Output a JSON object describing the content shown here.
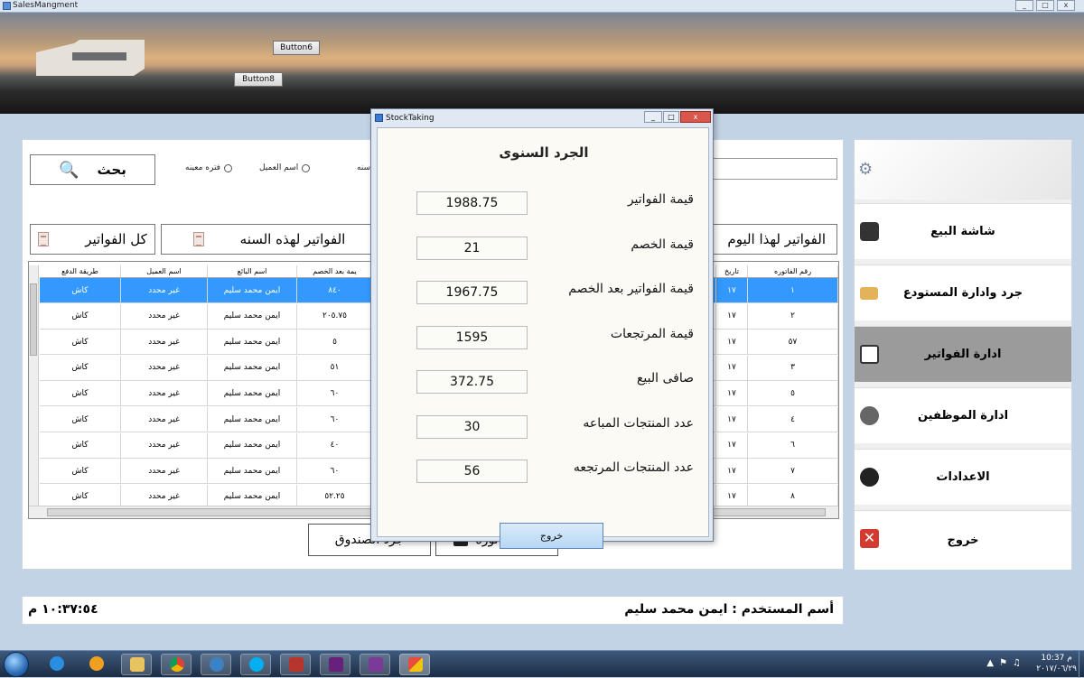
{
  "window": {
    "title": "SalesMangment",
    "controls": [
      "_",
      "□",
      "x"
    ]
  },
  "header": {
    "button6": "Button6",
    "button8": "Button8"
  },
  "filters": {
    "search_label": "بحث",
    "radio_period": "فتره معينه",
    "radio_customer": "اسم العميل",
    "radio_year": "سنه",
    "all_invoices": "كل الفواتير",
    "year_invoices": "الفواتير لهذه السنه",
    "today_invoices": "الفواتير لهذا اليوم"
  },
  "grid": {
    "columns": [
      "رقم الفاتوره",
      "تاريخ",
      "يمة بعد الخصم",
      "اسم البائع",
      "اسم العميل",
      "طريقة الدفع"
    ],
    "rows": [
      [
        "١",
        "١٧",
        "٨٤٠",
        "ايمن محمد سليم",
        "غير محدد",
        "كاش"
      ],
      [
        "٢",
        "١٧",
        "٢٠٥.٧٥",
        "ايمن محمد سليم",
        "غير محدد",
        "كاش"
      ],
      [
        "٥٧",
        "١٧",
        "٥",
        "ايمن محمد سليم",
        "غير محدد",
        "كاش"
      ],
      [
        "٣",
        "١٧",
        "٥١",
        "ايمن محمد سليم",
        "غير محدد",
        "كاش"
      ],
      [
        "٥",
        "١٧",
        "٦٠",
        "ايمن محمد سليم",
        "غير محدد",
        "كاش"
      ],
      [
        "٤",
        "١٧",
        "٦٠",
        "ايمن محمد سليم",
        "غير محدد",
        "كاش"
      ],
      [
        "٦",
        "١٧",
        "٤٠",
        "ايمن محمد سليم",
        "غير محدد",
        "كاش"
      ],
      [
        "٧",
        "١٧",
        "٦٠",
        "ايمن محمد سليم",
        "غير محدد",
        "كاش"
      ],
      [
        "٨",
        "١٧",
        "٥٢.٢٥",
        "ايمن محمد سليم",
        "غير محدد",
        "كاش"
      ]
    ]
  },
  "bottom_buttons": {
    "delete_invoice": "حذف فاتورة",
    "stocktake": "جرد الصندوق"
  },
  "sidebar": {
    "items": [
      {
        "label": "شاشة البيع",
        "icon": "cart-icon"
      },
      {
        "label": "جرد وادارة المستودع",
        "icon": "warehouse-icon"
      },
      {
        "label": "ادارة الفواتير",
        "icon": "invoice-icon"
      },
      {
        "label": "ادارة الموظفين",
        "icon": "employee-icon"
      },
      {
        "label": "الاعدادات",
        "icon": "wrench-icon"
      },
      {
        "label": "خروج",
        "icon": "exit-icon"
      }
    ]
  },
  "status": {
    "user_label": "أسم المستخدم :",
    "user_name": "ايمن محمد سليم",
    "clock": "١٠:٣٧:٥٤ م"
  },
  "dialog": {
    "title": "StockTaking",
    "heading": "الجرد السنوى",
    "fields": [
      {
        "label": "قيمة الفواتير",
        "value": "1988.75"
      },
      {
        "label": "قيمة الخصم",
        "value": "21"
      },
      {
        "label": "قيمة الفواتير بعد الخصم",
        "value": "1967.75"
      },
      {
        "label": "قيمة المرتجعات",
        "value": "1595"
      },
      {
        "label": "صافى البيع",
        "value": "372.75"
      },
      {
        "label": "عدد المنتجات المباعه",
        "value": "30"
      },
      {
        "label": "عدد المنتجات المرتجعه",
        "value": "56"
      }
    ],
    "exit_label": "خروج"
  },
  "taskbar": {
    "time": "10:37 م",
    "date": "٢٠١٧/٠٦/٢٩"
  }
}
